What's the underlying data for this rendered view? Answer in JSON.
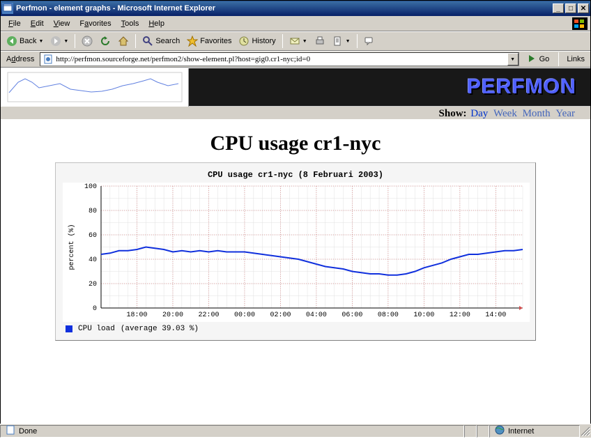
{
  "window": {
    "title": "Perfmon - element graphs - Microsoft Internet Explorer"
  },
  "menu": {
    "file": "File",
    "edit": "Edit",
    "view": "View",
    "favorites": "Favorites",
    "tools": "Tools",
    "help": "Help"
  },
  "toolbar": {
    "back": "Back",
    "search": "Search",
    "favorites": "Favorites",
    "history": "History"
  },
  "address": {
    "label": "Address",
    "url": "http://perfmon.sourceforge.net/perfmon2/show-element.pl?host=gig0.cr1-nyc;id=0",
    "go": "Go",
    "links": "Links"
  },
  "show": {
    "label": "Show:",
    "day": "Day",
    "week": "Week",
    "month": "Month",
    "year": "Year"
  },
  "brand": "PERFMON",
  "page_title": "CPU usage cr1-nyc",
  "chart_title": "CPU usage cr1-nyc (8 Februari 2003)",
  "ylabel": "percent (%)",
  "legend": {
    "name": "CPU load",
    "avg": "(average 39.03 %)"
  },
  "status": {
    "done": "Done",
    "zone": "Internet"
  },
  "chart_data": {
    "type": "line",
    "title": "CPU usage cr1-nyc (8 Februari 2003)",
    "ylabel": "percent (%)",
    "ylim": [
      0,
      100
    ],
    "yticks": [
      0,
      20,
      40,
      60,
      80,
      100
    ],
    "xticks": [
      "18:00",
      "20:00",
      "22:00",
      "00:00",
      "02:00",
      "04:00",
      "06:00",
      "08:00",
      "10:00",
      "12:00",
      "14:00"
    ],
    "series": [
      {
        "name": "CPU load",
        "color": "#1030dd",
        "x": [
          "16:00",
          "16:30",
          "17:00",
          "17:30",
          "18:00",
          "18:30",
          "19:00",
          "19:30",
          "20:00",
          "20:30",
          "21:00",
          "21:30",
          "22:00",
          "22:30",
          "23:00",
          "23:30",
          "00:00",
          "00:30",
          "01:00",
          "01:30",
          "02:00",
          "02:30",
          "03:00",
          "03:30",
          "04:00",
          "04:30",
          "05:00",
          "05:30",
          "06:00",
          "06:30",
          "07:00",
          "07:30",
          "08:00",
          "08:30",
          "09:00",
          "09:30",
          "10:00",
          "10:30",
          "11:00",
          "11:30",
          "12:00",
          "12:30",
          "13:00",
          "13:30",
          "14:00",
          "14:30",
          "15:00",
          "15:30"
        ],
        "values": [
          44,
          45,
          47,
          47,
          48,
          50,
          49,
          48,
          46,
          47,
          46,
          47,
          46,
          47,
          46,
          46,
          46,
          45,
          44,
          43,
          42,
          41,
          40,
          38,
          36,
          34,
          33,
          32,
          30,
          29,
          28,
          28,
          27,
          27,
          28,
          30,
          33,
          35,
          37,
          40,
          42,
          44,
          44,
          45,
          46,
          47,
          47,
          48
        ]
      }
    ],
    "legend_note": "average 39.03 %"
  }
}
